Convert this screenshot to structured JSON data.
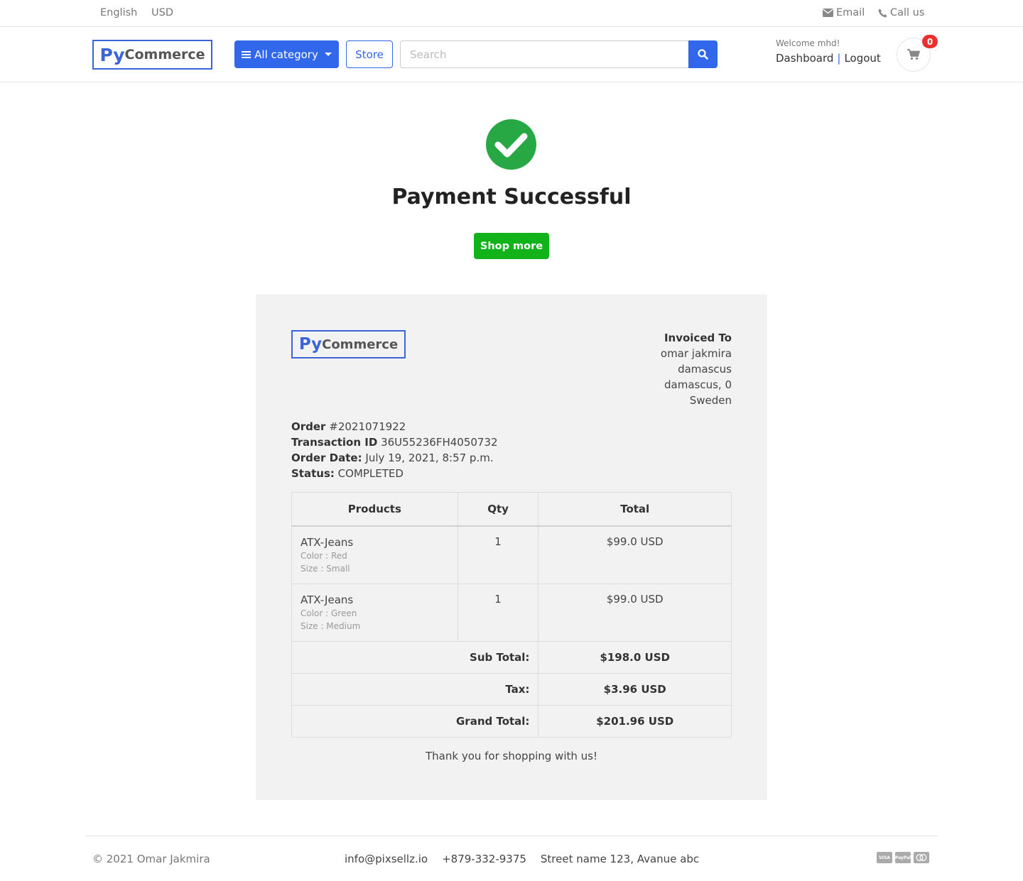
{
  "topbar": {
    "language": "English",
    "currency": "USD",
    "email_label": "Email",
    "call_label": "Call us"
  },
  "header": {
    "logo_py": "Py",
    "logo_commerce": "Commerce",
    "category_button": "All category",
    "store_button": "Store",
    "search_placeholder": "Search",
    "welcome": "Welcome mhd!",
    "dashboard_link": "Dashboard",
    "separator": "|",
    "logout_link": "Logout",
    "cart_count": "0"
  },
  "success": {
    "title": "Payment Successful",
    "shop_more": "Shop more"
  },
  "invoice": {
    "logo_py": "Py",
    "logo_commerce": "Commerce",
    "invoiced_to_heading": "Invoiced To",
    "invoiced_to": [
      "omar jakmira",
      "damascus",
      "damascus, 0",
      "Sweden"
    ],
    "order_label": "Order",
    "order_number": "#2021071922",
    "transaction_label": "Transaction ID",
    "transaction_id": "36U55236FH4050732",
    "order_date_label": "Order Date:",
    "order_date": "July 19, 2021, 8:57 p.m.",
    "status_label": "Status:",
    "status": "COMPLETED",
    "columns": {
      "products": "Products",
      "qty": "Qty",
      "total": "Total"
    },
    "items": [
      {
        "name": "ATX-Jeans",
        "color": "Color : Red",
        "size": "Size : Small",
        "qty": "1",
        "total": "$99.0 USD"
      },
      {
        "name": "ATX-Jeans",
        "color": "Color : Green",
        "size": "Size : Medium",
        "qty": "1",
        "total": "$99.0 USD"
      }
    ],
    "subtotal_label": "Sub Total:",
    "subtotal": "$198.0 USD",
    "tax_label": "Tax:",
    "tax": "$3.96 USD",
    "grand_total_label": "Grand Total:",
    "grand_total": "$201.96 USD",
    "thanks": "Thank you for shopping with us!"
  },
  "footer": {
    "copyright": "© 2021 Omar Jakmira",
    "email": "info@pixsellz.io",
    "phone": "+879-332-9375",
    "address": "Street name 123, Avanue abc",
    "cards": [
      "VISA",
      "PayPal",
      "MC"
    ]
  },
  "colors": {
    "brand_blue": "#3167eb",
    "success_green": "#12b21b",
    "check_green": "#28a745",
    "badge_red": "#e8312f"
  }
}
